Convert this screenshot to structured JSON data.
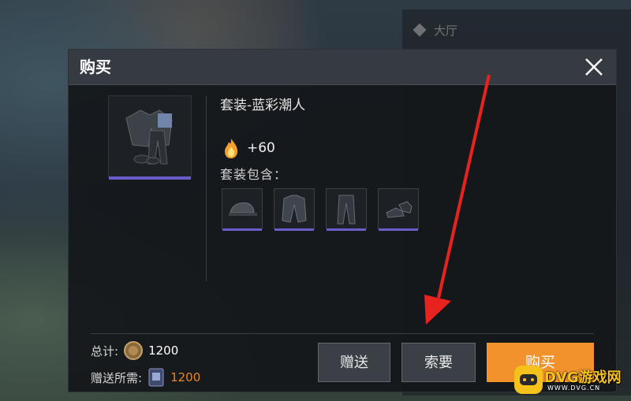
{
  "dialog": {
    "title": "购买",
    "item": {
      "name": "套装-蓝彩潮人",
      "points": "+60",
      "includes_label": "套装包含："
    },
    "parts": [
      "hat",
      "jacket",
      "pants",
      "shoes"
    ],
    "footer": {
      "total_label": "总计:",
      "total_amount": "1200",
      "gift_cost_label": "赠送所需:",
      "gift_cost_amount": "1200"
    },
    "buttons": {
      "gift": "赠送",
      "request": "索要",
      "buy": "购买"
    }
  },
  "background": {
    "panel_tag": "大厅"
  },
  "watermark": {
    "main": "DVG游戏网",
    "sub": "WWW.DVG.CN"
  },
  "colors": {
    "accent": "#f2922c",
    "rarity": "#6b5dc9",
    "annotation_arrow": "#e8231f"
  },
  "icons": {
    "close": "close-icon",
    "points": "flame-icon",
    "currency": "coin-icon",
    "gift_card": "gift-card-icon"
  }
}
